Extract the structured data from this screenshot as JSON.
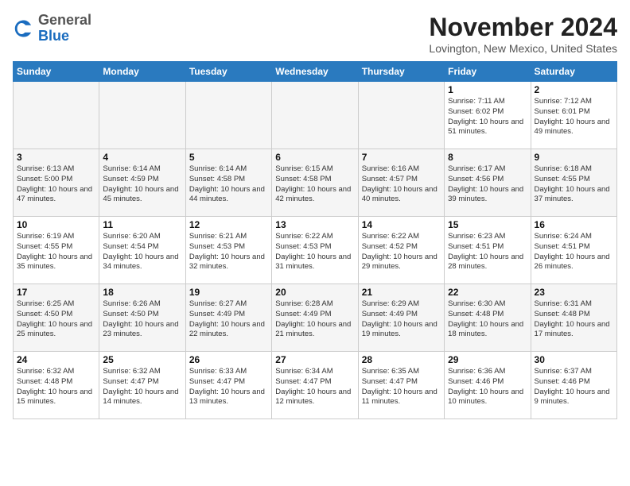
{
  "header": {
    "logo_general": "General",
    "logo_blue": "Blue",
    "month_title": "November 2024",
    "location": "Lovington, New Mexico, United States"
  },
  "weekdays": [
    "Sunday",
    "Monday",
    "Tuesday",
    "Wednesday",
    "Thursday",
    "Friday",
    "Saturday"
  ],
  "weeks": [
    [
      {
        "day": "",
        "empty": true
      },
      {
        "day": "",
        "empty": true
      },
      {
        "day": "",
        "empty": true
      },
      {
        "day": "",
        "empty": true
      },
      {
        "day": "",
        "empty": true
      },
      {
        "day": "1",
        "sunrise": "7:11 AM",
        "sunset": "6:02 PM",
        "daylight": "10 hours and 51 minutes."
      },
      {
        "day": "2",
        "sunrise": "7:12 AM",
        "sunset": "6:01 PM",
        "daylight": "10 hours and 49 minutes."
      }
    ],
    [
      {
        "day": "3",
        "sunrise": "6:13 AM",
        "sunset": "5:00 PM",
        "daylight": "10 hours and 47 minutes."
      },
      {
        "day": "4",
        "sunrise": "6:14 AM",
        "sunset": "4:59 PM",
        "daylight": "10 hours and 45 minutes."
      },
      {
        "day": "5",
        "sunrise": "6:14 AM",
        "sunset": "4:58 PM",
        "daylight": "10 hours and 44 minutes."
      },
      {
        "day": "6",
        "sunrise": "6:15 AM",
        "sunset": "4:58 PM",
        "daylight": "10 hours and 42 minutes."
      },
      {
        "day": "7",
        "sunrise": "6:16 AM",
        "sunset": "4:57 PM",
        "daylight": "10 hours and 40 minutes."
      },
      {
        "day": "8",
        "sunrise": "6:17 AM",
        "sunset": "4:56 PM",
        "daylight": "10 hours and 39 minutes."
      },
      {
        "day": "9",
        "sunrise": "6:18 AM",
        "sunset": "4:55 PM",
        "daylight": "10 hours and 37 minutes."
      }
    ],
    [
      {
        "day": "10",
        "sunrise": "6:19 AM",
        "sunset": "4:55 PM",
        "daylight": "10 hours and 35 minutes."
      },
      {
        "day": "11",
        "sunrise": "6:20 AM",
        "sunset": "4:54 PM",
        "daylight": "10 hours and 34 minutes."
      },
      {
        "day": "12",
        "sunrise": "6:21 AM",
        "sunset": "4:53 PM",
        "daylight": "10 hours and 32 minutes."
      },
      {
        "day": "13",
        "sunrise": "6:22 AM",
        "sunset": "4:53 PM",
        "daylight": "10 hours and 31 minutes."
      },
      {
        "day": "14",
        "sunrise": "6:22 AM",
        "sunset": "4:52 PM",
        "daylight": "10 hours and 29 minutes."
      },
      {
        "day": "15",
        "sunrise": "6:23 AM",
        "sunset": "4:51 PM",
        "daylight": "10 hours and 28 minutes."
      },
      {
        "day": "16",
        "sunrise": "6:24 AM",
        "sunset": "4:51 PM",
        "daylight": "10 hours and 26 minutes."
      }
    ],
    [
      {
        "day": "17",
        "sunrise": "6:25 AM",
        "sunset": "4:50 PM",
        "daylight": "10 hours and 25 minutes."
      },
      {
        "day": "18",
        "sunrise": "6:26 AM",
        "sunset": "4:50 PM",
        "daylight": "10 hours and 23 minutes."
      },
      {
        "day": "19",
        "sunrise": "6:27 AM",
        "sunset": "4:49 PM",
        "daylight": "10 hours and 22 minutes."
      },
      {
        "day": "20",
        "sunrise": "6:28 AM",
        "sunset": "4:49 PM",
        "daylight": "10 hours and 21 minutes."
      },
      {
        "day": "21",
        "sunrise": "6:29 AM",
        "sunset": "4:49 PM",
        "daylight": "10 hours and 19 minutes."
      },
      {
        "day": "22",
        "sunrise": "6:30 AM",
        "sunset": "4:48 PM",
        "daylight": "10 hours and 18 minutes."
      },
      {
        "day": "23",
        "sunrise": "6:31 AM",
        "sunset": "4:48 PM",
        "daylight": "10 hours and 17 minutes."
      }
    ],
    [
      {
        "day": "24",
        "sunrise": "6:32 AM",
        "sunset": "4:48 PM",
        "daylight": "10 hours and 15 minutes."
      },
      {
        "day": "25",
        "sunrise": "6:32 AM",
        "sunset": "4:47 PM",
        "daylight": "10 hours and 14 minutes."
      },
      {
        "day": "26",
        "sunrise": "6:33 AM",
        "sunset": "4:47 PM",
        "daylight": "10 hours and 13 minutes."
      },
      {
        "day": "27",
        "sunrise": "6:34 AM",
        "sunset": "4:47 PM",
        "daylight": "10 hours and 12 minutes."
      },
      {
        "day": "28",
        "sunrise": "6:35 AM",
        "sunset": "4:47 PM",
        "daylight": "10 hours and 11 minutes."
      },
      {
        "day": "29",
        "sunrise": "6:36 AM",
        "sunset": "4:46 PM",
        "daylight": "10 hours and 10 minutes."
      },
      {
        "day": "30",
        "sunrise": "6:37 AM",
        "sunset": "4:46 PM",
        "daylight": "10 hours and 9 minutes."
      }
    ]
  ]
}
